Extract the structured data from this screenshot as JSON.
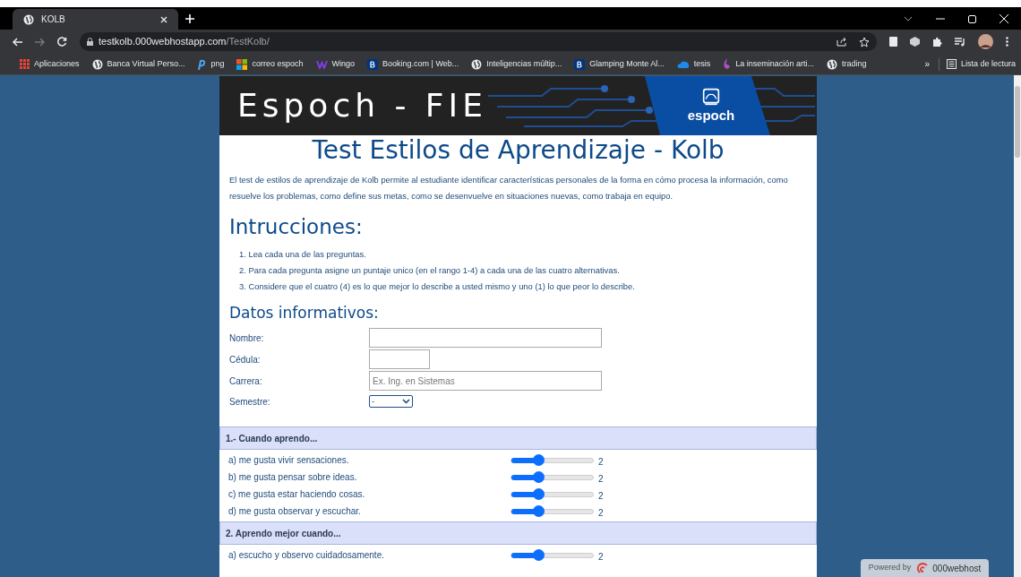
{
  "browser": {
    "tab": {
      "title": "KOLB"
    },
    "url": {
      "host": "testkolb.000webhostapp.com",
      "path": "/TestKolb/"
    },
    "bookmarks": [
      {
        "label": "Aplicaciones",
        "kind": "apps"
      },
      {
        "label": "Banca Virtual Perso...",
        "kind": "globe"
      },
      {
        "label": "png",
        "kind": "p"
      },
      {
        "label": "correo espoch",
        "kind": "ms"
      },
      {
        "label": "Wingo",
        "kind": "w"
      },
      {
        "label": "Booking.com | Web...",
        "kind": "b"
      },
      {
        "label": "Inteligencias múltip...",
        "kind": "globe"
      },
      {
        "label": "Glamping Monte Al...",
        "kind": "b"
      },
      {
        "label": "tesis",
        "kind": "cloud"
      },
      {
        "label": "La inseminación arti...",
        "kind": "drop"
      },
      {
        "label": "trading",
        "kind": "globe"
      }
    ],
    "more": "»",
    "reading_list": "Lista de lectura"
  },
  "page": {
    "banner": {
      "title": "Espoch - FIE",
      "logo_text": "espoch"
    },
    "title": "Test Estilos de Aprendizaje - Kolb",
    "intro": "El test de estilos de aprendizaje de Kolb permite al estudiante identificar características personales de la forma en cómo procesa la información, como resuelve los problemas, como define sus metas, como se desenvuelve en situaciones nuevas, como trabaja en equipo.",
    "instructions_heading": "Intrucciones:",
    "instructions": [
      "1. Lea cada una de las preguntas.",
      "2. Para cada pregunta asigne un puntaje unico (en el rango 1-4) a cada una de las cuatro alternativas.",
      "3. Considere que el cuatro (4) es lo que mejor lo describe a usted mismo y uno (1) lo que peor lo describe."
    ],
    "data_heading": "Datos informativos:",
    "fields": [
      {
        "label": "Nombre:",
        "kind": "text"
      },
      {
        "label": "Cédula:",
        "kind": "short"
      },
      {
        "label": "Carrera:",
        "kind": "text",
        "placeholder": "Ex. Ing. en Sistemas"
      },
      {
        "label": "Semestre:",
        "kind": "select",
        "value": "-"
      }
    ],
    "questions": [
      {
        "title": "1.- Cuando aprendo...",
        "options": [
          {
            "label": "a) me gusta vivir sensaciones.",
            "level": 0.33,
            "reading": "2"
          },
          {
            "label": "b) me gusta pensar sobre ideas.",
            "level": 0.33,
            "reading": "2"
          },
          {
            "label": "c) me gusta estar haciendo cosas.",
            "level": 0.33,
            "reading": "2"
          },
          {
            "label": "d) me gusta observar y escuchar.",
            "level": 0.33,
            "reading": "2"
          }
        ]
      },
      {
        "title": "2. Aprendo mejor cuando...",
        "options": [
          {
            "label": "a) escucho y observo cuidadosamente.",
            "level": 0.33,
            "reading": "2"
          }
        ]
      }
    ]
  },
  "powered_by": {
    "prefix": "Powered by",
    "brand": "000webhost"
  }
}
